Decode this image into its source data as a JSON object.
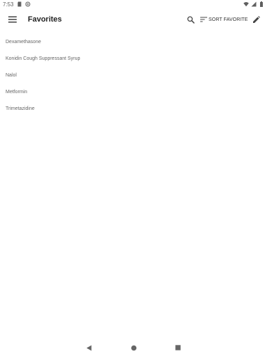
{
  "status_bar": {
    "time": "7:53",
    "icons": [
      "sd-card-icon",
      "data-saver-icon",
      "wifi-icon",
      "signal-icon",
      "battery-icon"
    ]
  },
  "app_bar": {
    "title": "Favorites",
    "sort_label": "SORT FAVORITE",
    "icons": {
      "menu": "menu-icon",
      "search": "search-icon",
      "sort": "sort-icon",
      "edit": "edit-icon"
    }
  },
  "favorites": [
    {
      "name": "Dexamethasone"
    },
    {
      "name": "Konidin Cough Suppressant Syrup"
    },
    {
      "name": "Nalol"
    },
    {
      "name": "Metformin"
    },
    {
      "name": "Trimetazidine"
    }
  ],
  "nav_bar": {
    "icons": [
      "back-icon",
      "home-icon",
      "recents-icon"
    ]
  },
  "colors": {
    "icon": "#5f5f5f",
    "title": "#222222",
    "list_text": "#666666",
    "background": "#ffffff"
  }
}
